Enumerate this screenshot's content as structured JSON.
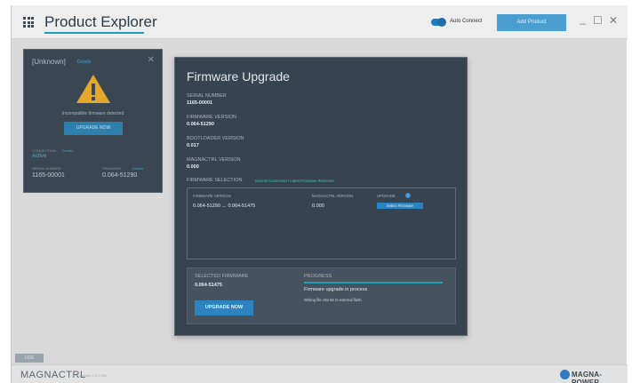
{
  "titlebar": {
    "app_title": "Product Explorer",
    "auto_connect_label": "Auto Connect",
    "auto_connect_on": true,
    "add_product_label": "Add Product",
    "minimize": "_",
    "maximize": "☐",
    "close": "✕"
  },
  "device_card": {
    "title": "[Unknown]",
    "mode": "Details",
    "close": "✕",
    "message": "Incompatible firmware detected",
    "upgrade_label": "UPGRADE NOW",
    "connection_label": "CONNECTION",
    "connection_details": "Details",
    "connection_status": "Active",
    "serial_label": "SERIAL NUMBER",
    "serial_value": "1165-00001",
    "firmware_label": "FIRMWARE",
    "firmware_details": "Details",
    "firmware_value": "0.064-51290"
  },
  "modal": {
    "title": "Firmware Upgrade",
    "serial_label": "SERIAL NUMBER",
    "serial_value": "1165-00001",
    "fw_version_label": "FIRMWARE VERSION",
    "fw_version_value": "0.064-51290",
    "bootloader_label": "BOOTLOADER VERSION",
    "bootloader_value": "0.017",
    "magnactrl_label": "MAGNACTRL VERSION",
    "magnactrl_value": "0.000",
    "selection_label": "FIRMWARE SELECTION",
    "selection_status": "Internet Connected • Latest Firmware Retrieved",
    "table": {
      "headers": [
        "FIRMWARE VERSION",
        "MAGNACTRL VERSION",
        "UPGRADE"
      ],
      "info_icon": "i",
      "rows": [
        {
          "firmware": "0.064-51290 → 0.064-51475",
          "magnactrl": "0.000",
          "action": "Select Firmware"
        }
      ]
    },
    "selected_label": "SELECTED FIRMWARE",
    "selected_value": "0.064-51475",
    "upgrade_now_label": "UPGRADE NOW",
    "progress_label": "PROGRESS",
    "progress_fraction": 1.0,
    "progress_status": "Firmware upgrade in process",
    "progress_detail": "Writing file chunks to external flash."
  },
  "footer": {
    "log_tab": "LOG",
    "brand": "MAGNACTRL",
    "brand_sub": "Version 0.0.0.000",
    "company": "MAGNA-POWER"
  },
  "colors": {
    "accent": "#1aa0b8",
    "button_blue": "#2d82c0",
    "warning": "#e3a82b",
    "panel_dark": "#37434f"
  }
}
